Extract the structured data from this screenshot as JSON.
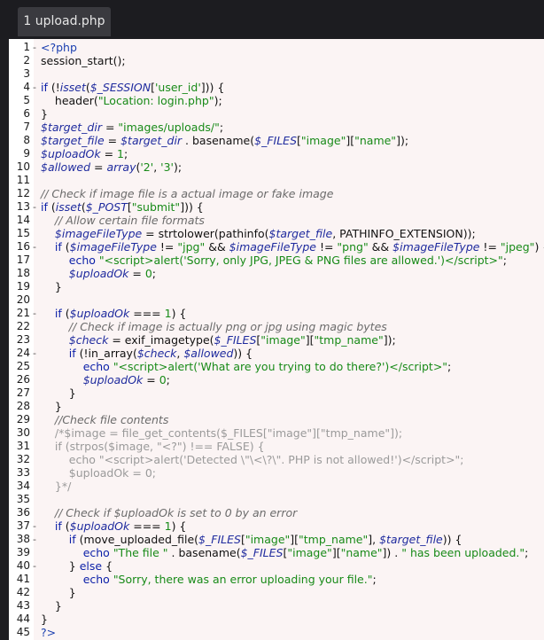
{
  "tab": {
    "title": "1 upload.php"
  },
  "lines": [
    {
      "n": "1",
      "fold": "-",
      "html": "<span class='t'>&lt;?php</span>"
    },
    {
      "n": "2",
      "fold": "",
      "html": "session_start();"
    },
    {
      "n": "3",
      "fold": "",
      "html": ""
    },
    {
      "n": "4",
      "fold": "-",
      "html": "<span class='k'>if</span> (!<span class='v'>isset</span>(<span class='v'>$_SESSION</span>[<span class='s'>'user_id'</span>])) {"
    },
    {
      "n": "5",
      "fold": "",
      "html": "    header(<span class='s'>\"Location: login.php\"</span>);"
    },
    {
      "n": "6",
      "fold": "",
      "html": "}"
    },
    {
      "n": "7",
      "fold": "",
      "html": "<span class='v'>$target_dir</span> = <span class='s'>\"images/uploads/\"</span>;"
    },
    {
      "n": "8",
      "fold": "",
      "html": "<span class='v'>$target_file</span> = <span class='v'>$target_dir</span> . basename(<span class='v'>$_FILES</span>[<span class='s'>\"image\"</span>][<span class='s'>\"name\"</span>]);"
    },
    {
      "n": "9",
      "fold": "",
      "html": "<span class='v'>$uploadOk</span> = <span class='s'>1</span>;"
    },
    {
      "n": "10",
      "fold": "",
      "html": "<span class='v'>$allowed</span> = <span class='v'>array</span>(<span class='s'>'2'</span>, <span class='s'>'3'</span>);"
    },
    {
      "n": "11",
      "fold": "",
      "html": ""
    },
    {
      "n": "12",
      "fold": "",
      "html": "<span class='c'>// Check if image file is a actual image or fake image</span>"
    },
    {
      "n": "13",
      "fold": "-",
      "html": "<span class='k'>if</span> (<span class='v'>isset</span>(<span class='v'>$_POST</span>[<span class='s'>\"submit\"</span>])) {"
    },
    {
      "n": "14",
      "fold": "",
      "html": "    <span class='c'>// Allow certain file formats</span>"
    },
    {
      "n": "15",
      "fold": "",
      "html": "    <span class='v'>$imageFileType</span> = strtolower(pathinfo(<span class='v'>$target_file</span>, PATHINFO_EXTENSION));"
    },
    {
      "n": "16",
      "fold": "-",
      "html": "    <span class='k'>if</span> (<span class='v'>$imageFileType</span> != <span class='s'>\"jpg\"</span> &amp;&amp; <span class='v'>$imageFileType</span> != <span class='s'>\"png\"</span> &amp;&amp; <span class='v'>$imageFileType</span> != <span class='s'>\"jpeg\"</span>) {"
    },
    {
      "n": "17",
      "fold": "",
      "html": "        <span class='k'>echo</span> <span class='s'>\"&lt;script&gt;alert('Sorry, only JPG, JPEG &amp; PNG files are allowed.')&lt;/script&gt;\"</span>;"
    },
    {
      "n": "18",
      "fold": "",
      "html": "        <span class='v'>$uploadOk</span> = <span class='s'>0</span>;"
    },
    {
      "n": "19",
      "fold": "",
      "html": "    }"
    },
    {
      "n": "20",
      "fold": "",
      "html": ""
    },
    {
      "n": "21",
      "fold": "-",
      "html": "    <span class='k'>if</span> (<span class='v'>$uploadOk</span> === <span class='s'>1</span>) {"
    },
    {
      "n": "22",
      "fold": "",
      "html": "        <span class='c'>// Check if image is actually png or jpg using magic bytes</span>"
    },
    {
      "n": "23",
      "fold": "",
      "html": "        <span class='v'>$check</span> = exif_imagetype(<span class='v'>$_FILES</span>[<span class='s'>\"image\"</span>][<span class='s'>\"tmp_name\"</span>]);"
    },
    {
      "n": "24",
      "fold": "-",
      "html": "        <span class='k'>if</span> (!in_array(<span class='v'>$check</span>, <span class='v'>$allowed</span>)) {"
    },
    {
      "n": "25",
      "fold": "",
      "html": "            <span class='k'>echo</span> <span class='s'>\"&lt;script&gt;alert('What are you trying to do there?')&lt;/script&gt;\"</span>;"
    },
    {
      "n": "26",
      "fold": "",
      "html": "            <span class='v'>$uploadOk</span> = <span class='s'>0</span>;"
    },
    {
      "n": "27",
      "fold": "",
      "html": "        }"
    },
    {
      "n": "28",
      "fold": "",
      "html": "    }"
    },
    {
      "n": "29",
      "fold": "",
      "html": "    <span class='c'>//Check file contents</span>"
    },
    {
      "n": "30",
      "fold": "",
      "html": "    <span class='g'>/*$image = file_get_contents($_FILES[\"image\"][\"tmp_name\"]);</span>"
    },
    {
      "n": "31",
      "fold": "",
      "html": "    <span class='g'>if (strpos($image, \"&lt;?\") !== FALSE) {</span>"
    },
    {
      "n": "32",
      "fold": "",
      "html": "        <span class='g'>echo \"&lt;script&gt;alert('Detected \\\"\\&lt;\\?\\\". PHP is not allowed!')&lt;/script&gt;\";</span>"
    },
    {
      "n": "33",
      "fold": "",
      "html": "        <span class='g'>$uploadOk = 0;</span>"
    },
    {
      "n": "34",
      "fold": "",
      "html": "    <span class='g'>}*/</span>"
    },
    {
      "n": "35",
      "fold": "",
      "html": ""
    },
    {
      "n": "36",
      "fold": "",
      "html": "    <span class='c'>// Check if $uploadOk is set to 0 by an error</span>"
    },
    {
      "n": "37",
      "fold": "-",
      "html": "    <span class='k'>if</span> (<span class='v'>$uploadOk</span> === <span class='s'>1</span>) {"
    },
    {
      "n": "38",
      "fold": "-",
      "html": "        <span class='k'>if</span> (move_uploaded_file(<span class='v'>$_FILES</span>[<span class='s'>\"image\"</span>][<span class='s'>\"tmp_name\"</span>], <span class='v'>$target_file</span>)) {"
    },
    {
      "n": "39",
      "fold": "",
      "html": "            <span class='k'>echo</span> <span class='s'>\"The file \"</span> . basename(<span class='v'>$_FILES</span>[<span class='s'>\"image\"</span>][<span class='s'>\"name\"</span>]) . <span class='s'>\" has been uploaded.\"</span>;"
    },
    {
      "n": "40",
      "fold": "-",
      "html": "        } <span class='k'>else</span> {"
    },
    {
      "n": "41",
      "fold": "",
      "html": "            <span class='k'>echo</span> <span class='s'>\"Sorry, there was an error uploading your file.\"</span>;"
    },
    {
      "n": "42",
      "fold": "",
      "html": "        }"
    },
    {
      "n": "43",
      "fold": "",
      "html": "    }"
    },
    {
      "n": "44",
      "fold": "",
      "html": "}"
    },
    {
      "n": "45",
      "fold": "",
      "html": "<span class='t'>?&gt;</span>"
    }
  ]
}
